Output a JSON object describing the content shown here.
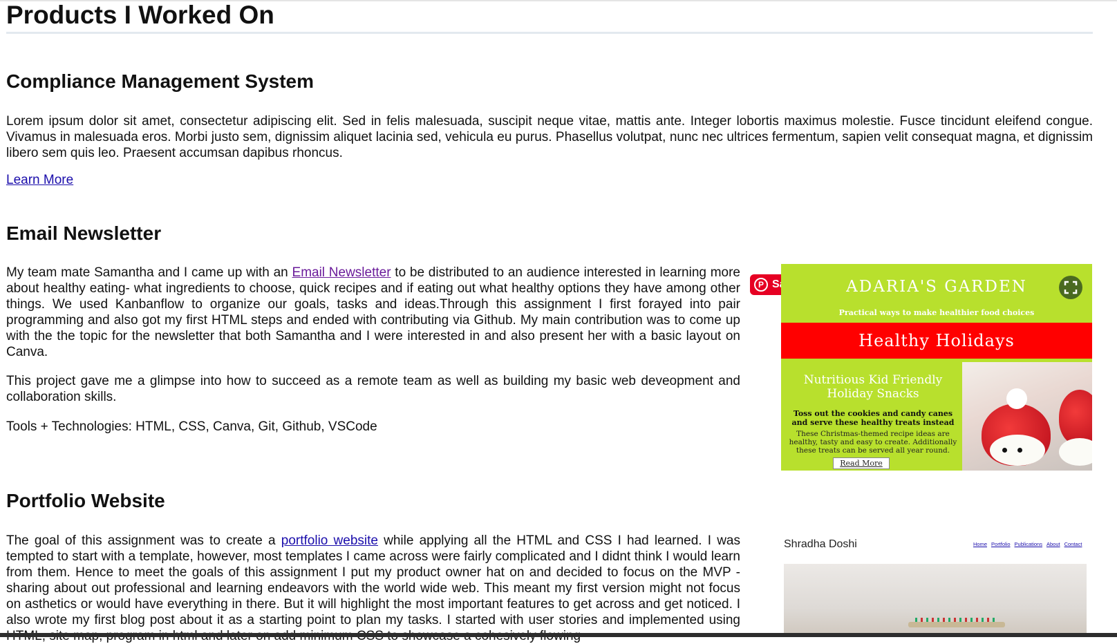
{
  "page": {
    "title": "Products I Worked On"
  },
  "sections": [
    {
      "title": "Compliance Management System",
      "paragraph": "Lorem ipsum dolor sit amet, consectetur adipiscing elit. Sed in felis malesuada, suscipit neque vitae, mattis ante. Integer lobortis maximus molestie. Fusce tincidunt eleifend congue. Vivamus in malesuada eros. Morbi justo sem, dignissim aliquet lacinia sed, vehicula eu purus. Phasellus volutpat, nunc nec ultrices fermentum, sapien velit consequat magna, et dignissim libero sem quis leo. Praesent accumsan dapibus rhoncus.",
      "link": "Learn More"
    },
    {
      "title": "Email Newsletter",
      "p1_before": "My team mate Samantha and I came up with an ",
      "p1_link": "Email Newsletter",
      "p1_after": " to be distributed to an audience interested in learning more about healthy eating- what ingredients to choose, quick recipes and if eating out what healthy options they have among other things. We used Kanbanflow to organize our goals, tasks and ideas.Through this assignment I first forayed into pair programming and also got my first HTML steps and ended with contributing via Github. My main contribution was to come up with the the topic for the newsletter that both Samantha and I were interested in and also present her with a basic layout on Canva.",
      "p2": "This project gave me a glimpse into how to succeed as a remote team as well as building my basic web deveopment and collaboration skills.",
      "p3": "Tools + Technologies: HTML, CSS, Canva, Git, Github, VSCode"
    },
    {
      "title": "Portfolio Website",
      "p1_before": "The goal of this assignment was to create a ",
      "p1_link": "portfolio website",
      "p1_after": " while applying all the HTML and CSS I had learned. I was tempted to start with a template, however, most templates I came across were fairly complicated and I didnt think I would learn from them. Hence to meet the goals of this assignment I put my product owner hat on and decided to focus on the MVP - sharing about out professional and learning endeavors with the world wide web. This meant my first version might not focus on asthetics or would have everything in there. But it will highlight the most important features to get across and get noticed. I also wrote my first blog post about it as a starting point to plan my tasks. I started with user stories and implemented using HTML, site map, program in html and later on add minimum CSS to showcase a cohesively flowing"
    }
  ],
  "pin_save": {
    "label": "Save",
    "icon": "pinterest-icon",
    "color": "#e60023"
  },
  "newsletter_image": {
    "brand": "ADARIA'S GARDEN",
    "tagline": "Practical ways to make healthier food choices",
    "banner": "Healthy Holidays",
    "subheading": "Nutritious Kid Friendly Holiday Snacks",
    "bold_text": "Toss out the cookies and candy canes and serve these healthy treats instead",
    "small_text": "These Christmas-themed recipe ideas are healthy, tasty and easy to create. Additionally these treats can be served all year round.",
    "button": "Read More",
    "expand_icon": "expand-icon",
    "colors": {
      "background": "#b8e02d",
      "banner": "#ff0000"
    }
  },
  "portfolio_image": {
    "name": "Shradha Doshi",
    "nav": [
      "Home",
      "Portfolio",
      "Publications",
      "About",
      "Contact"
    ]
  }
}
